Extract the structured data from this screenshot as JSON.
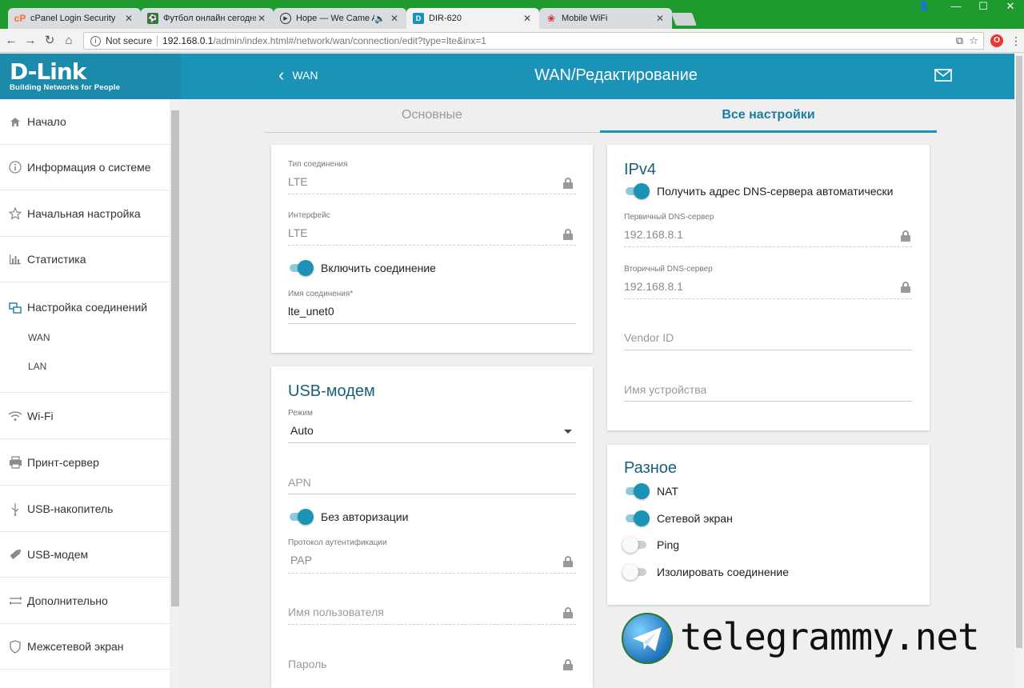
{
  "browser": {
    "tabs": [
      {
        "label": "cPanel Login Security",
        "favicon": "cpanel-icon",
        "color": "#ff6c2c"
      },
      {
        "label": "Футбол онлайн сегодня",
        "favicon": "football-icon",
        "color": "#2e7d32"
      },
      {
        "label": "Hope — We Came As",
        "favicon": "play-icon",
        "color": "#333333"
      },
      {
        "label": "DIR-620",
        "favicon": "dlink-icon",
        "color": "#1a93b6"
      },
      {
        "label": "Mobile WiFi",
        "favicon": "huawei-icon",
        "color": "#d32f2f"
      }
    ],
    "security_label": "Not secure",
    "url_host": "192.168.0.1",
    "url_path": "/admin/index.html#/network/wan/connection/edit?type=lte&inx=1"
  },
  "logo": {
    "brand": "D-Link",
    "tagline": "Building Networks for People"
  },
  "header": {
    "back_label": "WAN",
    "title": "WAN/Редактирование"
  },
  "sidebar": {
    "items": [
      {
        "label": "Начало",
        "icon": "home-icon"
      },
      {
        "label": "Информация о системе",
        "icon": "info-icon"
      },
      {
        "label": "Начальная настройка",
        "icon": "star-icon"
      },
      {
        "label": "Статистика",
        "icon": "bar-chart-icon"
      },
      {
        "label": "Настройка соединений",
        "icon": "connections-icon"
      },
      {
        "label": "Wi-Fi",
        "icon": "wifi-icon"
      },
      {
        "label": "Принт-сервер",
        "icon": "printer-icon"
      },
      {
        "label": "USB-накопитель",
        "icon": "usb-icon"
      },
      {
        "label": "USB-модем",
        "icon": "modem-icon"
      },
      {
        "label": "Дополнительно",
        "icon": "settings-arrows-icon"
      },
      {
        "label": "Межсетевой экран",
        "icon": "shield-icon"
      }
    ],
    "subitems": [
      "WAN",
      "LAN"
    ]
  },
  "tabs": {
    "basic": "Основные",
    "all": "Все настройки"
  },
  "connection": {
    "type_label": "Тип соединения",
    "type_value": "LTE",
    "iface_label": "Интерфейс",
    "iface_value": "LTE",
    "enable_label": "Включить соединение",
    "name_label": "Имя соединения*",
    "name_value": "lte_unet0"
  },
  "usb_modem": {
    "title": "USB-модем",
    "mode_label": "Режим",
    "mode_value": "Auto",
    "apn_placeholder": "APN",
    "noauth_label": "Без авторизации",
    "auth_proto_label": "Протокол аутентификации",
    "auth_proto_value": "PAP",
    "user_placeholder": "Имя пользователя",
    "password_placeholder": "Пароль"
  },
  "ipv4": {
    "title": "IPv4",
    "auto_dns_label": "Получить адрес DNS-сервера автоматически",
    "primary_label": "Первичный DNS-сервер",
    "primary_value": "192.168.8.1",
    "secondary_label": "Вторичный DNS-сервер",
    "secondary_value": "192.168.8.1",
    "vendor_placeholder": "Vendor ID",
    "device_placeholder": "Имя устройства"
  },
  "misc": {
    "title": "Разное",
    "nat_label": "NAT",
    "firewall_label": "Сетевой экран",
    "ping_label": "Ping",
    "isolate_label": "Изолировать соединение"
  },
  "watermark": "telegrammy.net",
  "colors": {
    "accent": "#1a93b6",
    "logo_bg": "#1b8aab",
    "tab_bar": "#1f9a2e"
  }
}
